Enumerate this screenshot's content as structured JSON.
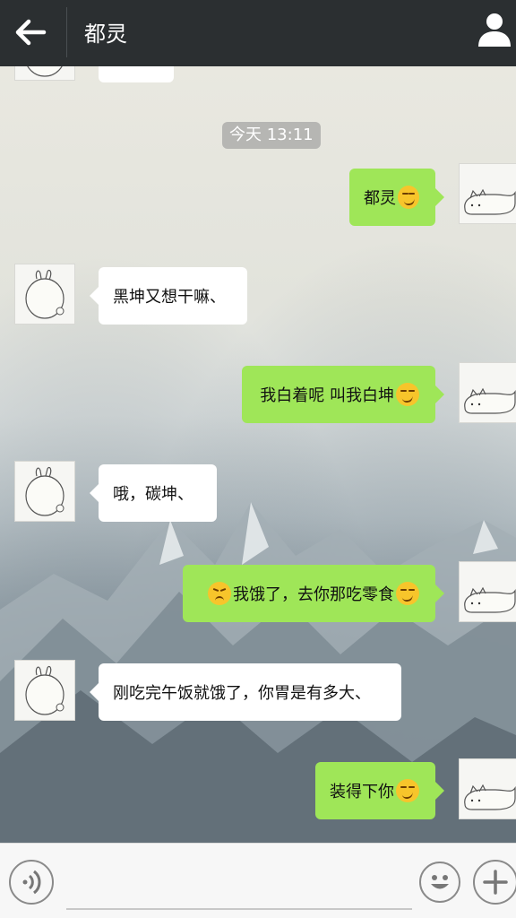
{
  "header": {
    "title": "都灵",
    "back_icon": "arrow-left-icon",
    "profile_icon": "person-icon",
    "bg_color": "#2b2f31"
  },
  "timestamp": "今天 13:11",
  "messages": [
    {
      "direction": "out",
      "text": "都灵",
      "emoji_after": "smirk"
    },
    {
      "direction": "in",
      "text": "黑坤又想干嘛、"
    },
    {
      "direction": "out",
      "text": "我白着呢 叫我白坤",
      "emoji_after": "smirk"
    },
    {
      "direction": "in",
      "text": "哦，碳坤、"
    },
    {
      "direction": "out",
      "emoji_before": "sad",
      "text": "我饿了，去你那吃零食",
      "emoji_after": "smirk"
    },
    {
      "direction": "in",
      "text": "刚吃完午饭就饿了，你胃是有多大、"
    },
    {
      "direction": "out",
      "text": "装得下你",
      "emoji_after": "smirk"
    }
  ],
  "colors": {
    "outgoing_bubble": "#9fe658",
    "incoming_bubble": "#ffffff"
  },
  "input_bar": {
    "voice_icon": "voice-icon",
    "emoji_icon": "emoji-icon",
    "plus_icon": "plus-icon",
    "value": ""
  }
}
